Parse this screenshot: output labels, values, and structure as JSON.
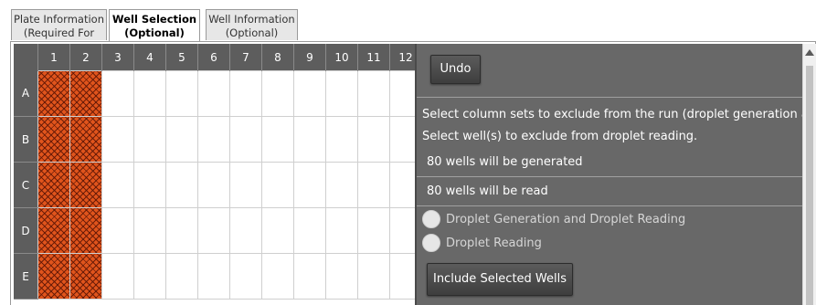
{
  "tabs": [
    {
      "line1": "Plate Information",
      "line2": "(Required For Run)"
    },
    {
      "line1": "Well Selection",
      "line2": "(Optional)"
    },
    {
      "line1": "Well Information",
      "line2": "(Optional)"
    }
  ],
  "plate": {
    "columns": [
      "1",
      "2",
      "3",
      "4",
      "5",
      "6",
      "7",
      "8",
      "9",
      "10",
      "11",
      "12"
    ],
    "rows": [
      "A",
      "B",
      "C",
      "D",
      "E"
    ],
    "selected_columns": [
      "1",
      "2"
    ],
    "selected_color": "#e0541c"
  },
  "panel": {
    "undo_label": "Undo",
    "instruction_1": "Select column sets to exclude from the run (droplet generation and",
    "instruction_2": "Select well(s) to exclude from droplet reading.",
    "generated_text": "80 wells will be generated",
    "read_text": "80 wells will be read",
    "radio_1": "Droplet Generation and Droplet Reading",
    "radio_2": "Droplet Reading",
    "include_label": "Include Selected Wells"
  }
}
